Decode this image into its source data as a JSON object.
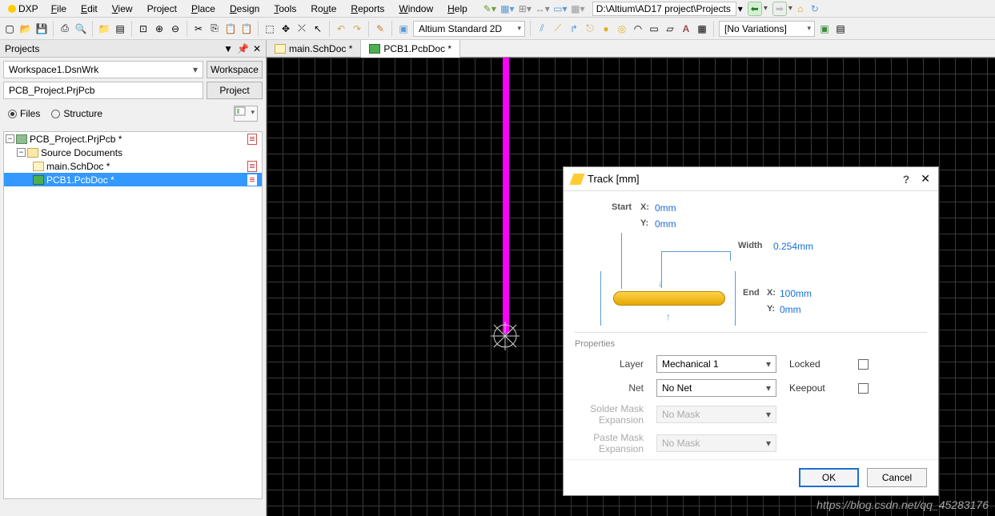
{
  "menu": {
    "dxp": "DXP",
    "items": [
      "File",
      "Edit",
      "View",
      "Project",
      "Place",
      "Design",
      "Tools",
      "Route",
      "Reports",
      "Window",
      "Help"
    ],
    "path": "D:\\Altium\\AD17 project\\Projects"
  },
  "toolbar2": {
    "viewMode": "Altium Standard 2D",
    "variations": "[No Variations]"
  },
  "projects": {
    "title": "Projects",
    "workspace": "Workspace1.DsnWrk",
    "workspaceBtn": "Workspace",
    "project": "PCB_Project.PrjPcb",
    "projectBtn": "Project",
    "radioFiles": "Files",
    "radioStructure": "Structure",
    "tree": {
      "root": "PCB_Project.PrjPcb *",
      "folder": "Source Documents",
      "sch": "main.SchDoc *",
      "pcb": "PCB1.PcbDoc *"
    }
  },
  "tabs": {
    "sch": "main.SchDoc *",
    "pcb": "PCB1.PcbDoc *"
  },
  "dialog": {
    "title": "Track [mm]",
    "start": "Start",
    "startX": "0mm",
    "startY": "0mm",
    "width": "Width",
    "widthVal": "0.254mm",
    "end": "End",
    "endX": "100mm",
    "endY": "0mm",
    "xLbl": "X:",
    "yLbl": "Y:",
    "propsTitle": "Properties",
    "layerLbl": "Layer",
    "layerVal": "Mechanical 1",
    "netLbl": "Net",
    "netVal": "No Net",
    "solderLbl1": "Solder Mask",
    "solderLbl2": "Expansion",
    "solderVal": "No Mask",
    "pasteLbl1": "Paste Mask",
    "pasteLbl2": "Expansion",
    "pasteVal": "No Mask",
    "locked": "Locked",
    "keepout": "Keepout",
    "ok": "OK",
    "cancel": "Cancel"
  },
  "watermark": "https://blog.csdn.net/qq_45283176"
}
